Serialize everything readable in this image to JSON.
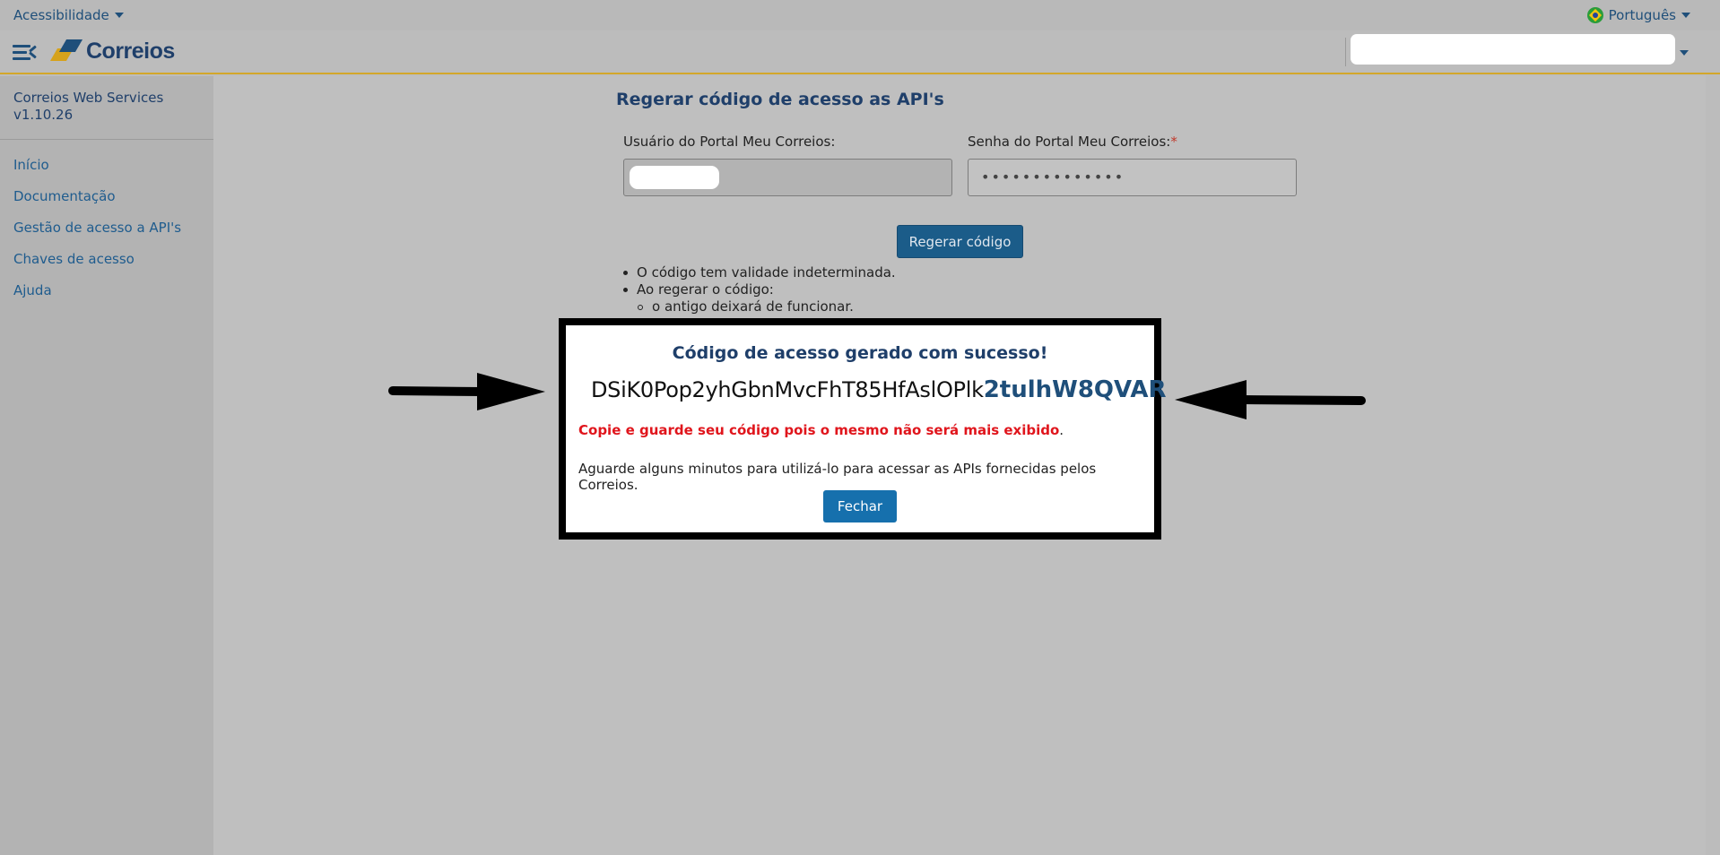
{
  "topbar": {
    "accessibility_label": "Acessibilidade",
    "language_label": "Português"
  },
  "header": {
    "brand": "Correios"
  },
  "sidebar": {
    "app_name": "Correios Web Services",
    "version": "v1.10.26",
    "items": [
      {
        "label": "Início"
      },
      {
        "label": "Documentação"
      },
      {
        "label": "Gestão de acesso a API's"
      },
      {
        "label": "Chaves de acesso"
      },
      {
        "label": "Ajuda"
      }
    ]
  },
  "main": {
    "title": "Regerar código de acesso as API's",
    "user_label": "Usuário do Portal Meu Correios:",
    "password_label": "Senha do Portal Meu Correios:",
    "required_mark": "*",
    "password_value": "••••••••••••••",
    "regen_button": "Regerar código",
    "bullets": [
      "O código tem validade indeterminada.",
      "Ao regerar o código:"
    ],
    "sub_bullet": "o antigo deixará de funcionar."
  },
  "modal": {
    "title": "Código de acesso gerado com sucesso!",
    "code_part1": "DSiK0Pop2yhGbnMvcFhT85HfAslOPlk",
    "code_part2": "2tulhW8QVAR",
    "warning": "Copie e guarde seu código pois o mesmo não será mais exibido",
    "warning_period": ".",
    "info": "Aguarde alguns minutos para utilizá-lo para acessar as APIs fornecidas pelos Correios.",
    "close_button": "Fechar"
  },
  "colors": {
    "brand_blue": "#1f4f7a",
    "brand_yellow": "#d6a21b",
    "warning_red": "#e0151c",
    "button_blue": "#1670ad"
  }
}
